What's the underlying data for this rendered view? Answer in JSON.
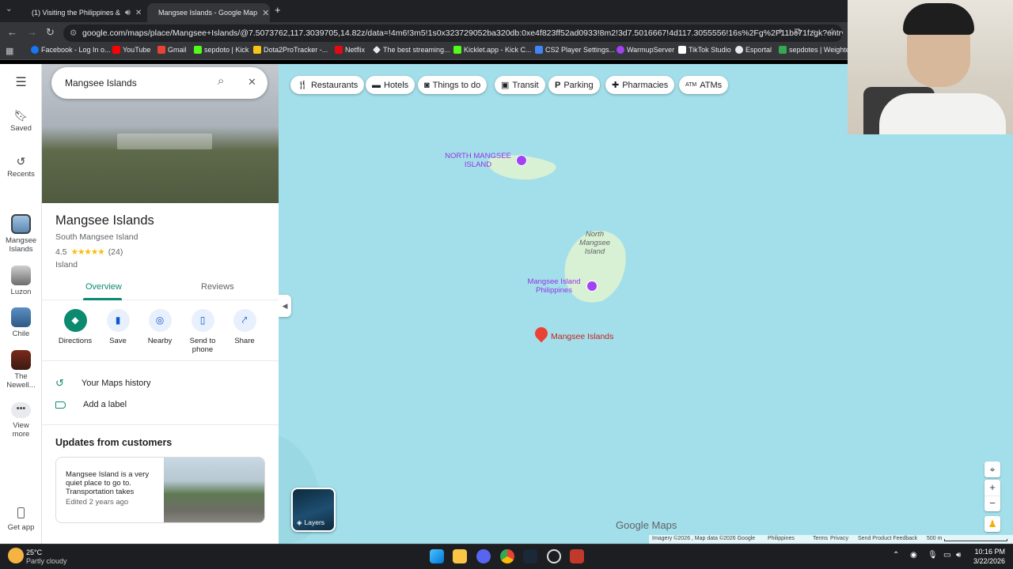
{
  "browser": {
    "tabs": [
      {
        "title": "(1) Visiting the Philippines &",
        "active": false
      },
      {
        "title": "Mangsee Islands - Google Map",
        "active": true
      }
    ],
    "url": "google.com/maps/place/Mangsee+Islands/@7.5073762,117.3039705,14.82z/data=!4m6!3m5!1s0x323729052ba320db:0xe4f823ff52ad0933!8m2!3d7.5016667!4d117.3055556!16s%2Fg%2F11bc71fzgk?entry=ttu...",
    "bookmarks": [
      "Facebook - Log In o...",
      "YouTube",
      "Gmail",
      "sepdoto | Kick",
      "Dota2ProTracker -...",
      "Netflix",
      "The best streaming...",
      "Kicklet.app - Kick C...",
      "CS2 Player Settings...",
      "WarmupServer",
      "TikTok Studio",
      "Esportal",
      "sepdotes | Weighte..."
    ]
  },
  "rail": {
    "saved": "Saved",
    "recents": "Recents",
    "items": [
      "Mangsee Islands",
      "Luzon",
      "Chile",
      "The Newell..."
    ],
    "view_more": "View more",
    "get_app": "Get app"
  },
  "panel": {
    "search_value": "Mangsee Islands",
    "title": "Mangsee Islands",
    "subtitle": "South Mangsee Island",
    "rating": "4.5",
    "stars": "★★★★★",
    "reviews_count": "(24)",
    "category": "Island",
    "tabs": {
      "overview": "Overview",
      "reviews": "Reviews"
    },
    "actions": {
      "directions": "Directions",
      "save": "Save",
      "nearby": "Nearby",
      "send": "Send to phone",
      "share": "Share"
    },
    "history": "Your Maps history",
    "label": "Add a label",
    "updates_title": "Updates from customers",
    "update_text": "Mangsee Island is a very quiet place to go to. Transportation takes",
    "update_time": "Edited 2 years ago"
  },
  "map": {
    "chips": [
      "Restaurants",
      "Hotels",
      "Things to do",
      "Transit",
      "Parking",
      "Pharmacies",
      "ATMs"
    ],
    "labels": {
      "north_island_caps": "NORTH MANGSEE ISLAND",
      "north_island": "North Mangsee Island",
      "poi": "Mangsee Island Philippines",
      "pin": "Mangsee Islands"
    },
    "layers": "Layers",
    "google_maps": "Google Maps",
    "footer": {
      "imagery": "Imagery ©2026 , Map data ©2026 Google",
      "country": "Philippines",
      "terms": "Terms",
      "privacy": "Privacy",
      "feedback": "Send Product Feedback",
      "scale": "500 m"
    },
    "colors": {
      "water": "#a3dfea",
      "land": "#d8f0d4",
      "pin": "#ea4335",
      "poi": "#a142f4"
    }
  },
  "taskbar": {
    "weather_temp": "25°C",
    "weather_desc": "Partly cloudy",
    "time": "10:16 PM",
    "date": "3/22/2026"
  }
}
